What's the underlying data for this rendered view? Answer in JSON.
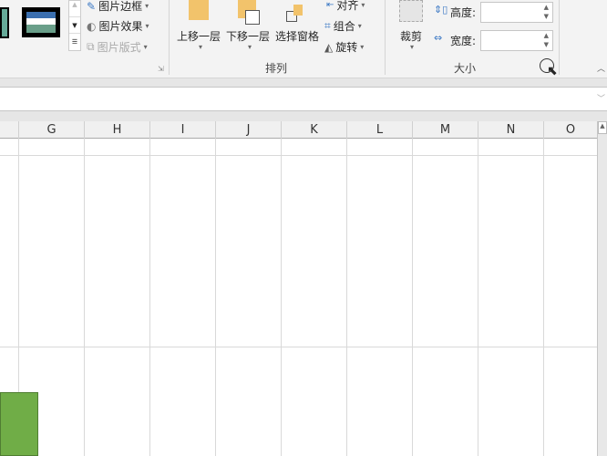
{
  "ribbon": {
    "picture_styles": {
      "border": "图片边框",
      "effects": "图片效果",
      "layout": "图片版式"
    },
    "arrange": {
      "group_label": "排列",
      "bring_forward": "上移一层",
      "send_backward": "下移一层",
      "selection_pane": "选择窗格",
      "align": "对齐",
      "group": "组合",
      "rotate": "旋转"
    },
    "size": {
      "group_label": "大小",
      "crop": "裁剪",
      "height_label": "高度:",
      "width_label": "宽度:",
      "height_value": "",
      "width_value": ""
    }
  },
  "columns": [
    "G",
    "H",
    "I",
    "J",
    "K",
    "L",
    "M",
    "N",
    "O"
  ],
  "colors": {
    "shape_fill": "#70ad47",
    "accent_orange": "#f2c36b"
  }
}
